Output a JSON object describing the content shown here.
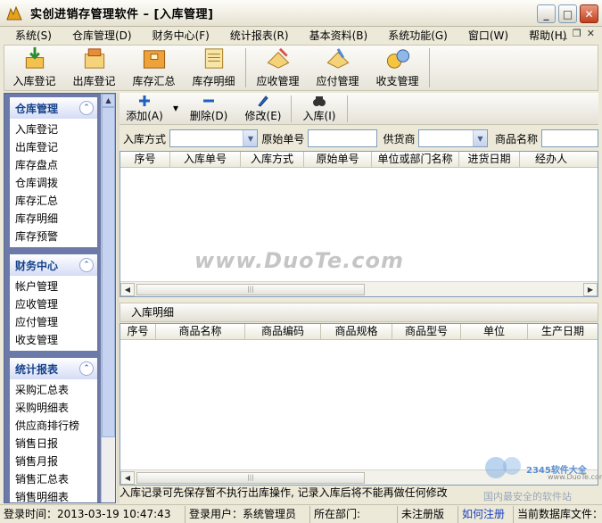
{
  "window": {
    "title": "实创进销存管理软件  – [入库管理]",
    "minimize_glyph": "_",
    "maximize_glyph": "□",
    "close_glyph": "✕",
    "mdi_min": "_",
    "mdi_restore": "❐",
    "mdi_close": "✕"
  },
  "menu": [
    {
      "label": "系统(S)"
    },
    {
      "label": "仓库管理(D)"
    },
    {
      "label": "财务中心(F)"
    },
    {
      "label": "统计报表(R)"
    },
    {
      "label": "基本资料(B)"
    },
    {
      "label": "系统功能(G)"
    },
    {
      "label": "窗口(W)"
    },
    {
      "label": "帮助(H)"
    }
  ],
  "toolbar": {
    "buttons": [
      {
        "label": "入库登记",
        "icon": "stock-in-icon"
      },
      {
        "label": "出库登记",
        "icon": "stock-out-icon"
      },
      {
        "label": "库存汇总",
        "icon": "stock-summary-icon"
      },
      {
        "label": "库存明细",
        "icon": "stock-detail-icon"
      },
      {
        "label": "应收管理",
        "icon": "receivable-icon"
      },
      {
        "label": "应付管理",
        "icon": "payable-icon"
      },
      {
        "label": "收支管理",
        "icon": "income-expense-icon"
      }
    ]
  },
  "sidebar": {
    "groups": [
      {
        "title": "仓库管理",
        "items": [
          "入库登记",
          "出库登记",
          "库存盘点",
          "仓库调拨",
          "库存汇总",
          "库存明细",
          "库存预警"
        ]
      },
      {
        "title": "财务中心",
        "items": [
          "帐户管理",
          "应收管理",
          "应付管理",
          "收支管理"
        ]
      },
      {
        "title": "统计报表",
        "items": [
          "采购汇总表",
          "采购明细表",
          "供应商排行榜",
          "销售日报",
          "销售月报",
          "销售汇总表",
          "销售明细表"
        ]
      }
    ]
  },
  "actions": {
    "add": "添加(A)",
    "delete": "删除(D)",
    "edit": "修改(E)",
    "stock_in": "入库(I)",
    "dropdown_glyph": "▾"
  },
  "filters": {
    "method_label": "入库方式",
    "method_value": "",
    "original_no_label": "原始单号",
    "original_no_value": "",
    "supplier_label": "供货商",
    "supplier_value": "",
    "product_name_label": "商品名称",
    "product_name_value": ""
  },
  "master_grid": {
    "columns": [
      "序号",
      "入库单号",
      "入库方式",
      "原始单号",
      "单位或部门名称",
      "进货日期",
      "经办人"
    ],
    "rows": []
  },
  "detail_section": {
    "title": "入库明细"
  },
  "detail_grid": {
    "columns": [
      "序号",
      "商品名称",
      "商品编码",
      "商品规格",
      "商品型号",
      "单位",
      "生产日期"
    ],
    "rows": []
  },
  "note": "入库记录可先保存暂不执行出库操作, 记录入库后将不能再做任何修改",
  "watermark": {
    "site": "www.DuoTe.com",
    "brand": "2345软件大全",
    "url": "www.DuoTe.com",
    "slogan": "国内最安全的软件站"
  },
  "statusbar": {
    "time": "登录时间：2013-03-19 10:47:43",
    "user": "登录用户：系统管理员",
    "dept": "所在部门:",
    "reg": "未注册版",
    "howto": "如何注册",
    "db": "当前数据库文件："
  },
  "colors": {
    "accent": "#15428b",
    "sidebar_bg": "#6b7aa8",
    "link": "#1a3fbf"
  }
}
